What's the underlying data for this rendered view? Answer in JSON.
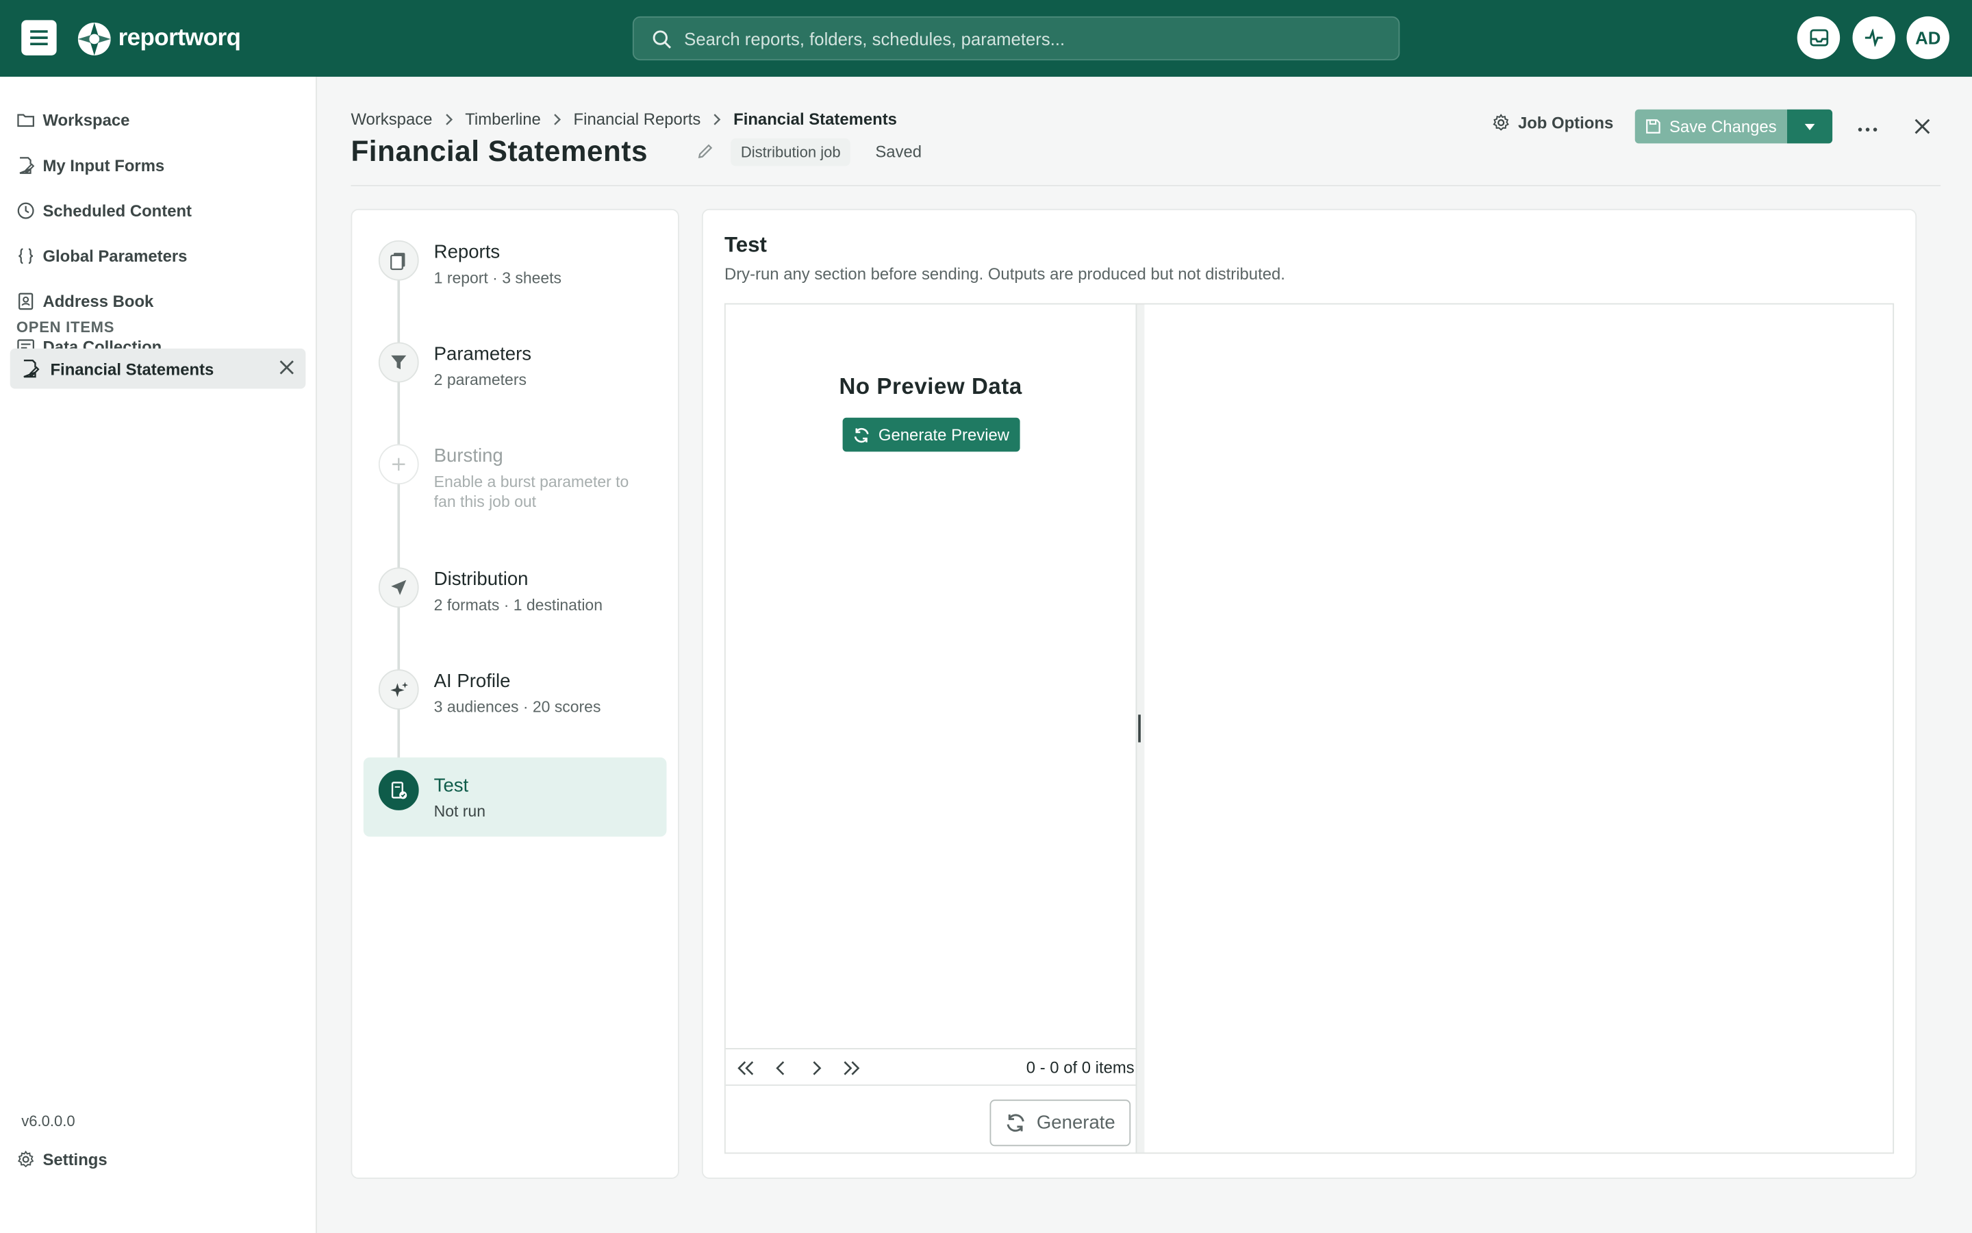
{
  "header": {
    "brand": "reportworq",
    "search_placeholder": "Search reports, folders, schedules, parameters...",
    "avatar_initials": "AD"
  },
  "sidebar": {
    "items": [
      {
        "label": "Workspace",
        "icon": "folder-icon"
      },
      {
        "label": "My Input Forms",
        "icon": "form-edit-icon"
      },
      {
        "label": "Scheduled Content",
        "icon": "clock-icon"
      },
      {
        "label": "Global Parameters",
        "icon": "braces-icon"
      },
      {
        "label": "Address Book",
        "icon": "contact-book-icon"
      },
      {
        "label": "Data Collection",
        "icon": "data-form-icon"
      }
    ],
    "open_items_label": "OPEN ITEMS",
    "open_items": [
      {
        "label": "Financial Statements"
      }
    ],
    "settings_label": "Settings",
    "version": "v6.0.0.0"
  },
  "breadcrumb": [
    "Workspace",
    "Timberline",
    "Financial Reports",
    "Financial Statements"
  ],
  "page": {
    "title": "Financial Statements",
    "badge": "Distribution job",
    "status": "Saved",
    "job_options_label": "Job Options",
    "save_label": "Save Changes"
  },
  "steps": [
    {
      "name": "Reports",
      "sub": "1 report · 3 sheets",
      "icon": "document-copy-icon",
      "state": "done"
    },
    {
      "name": "Parameters",
      "sub": "2 parameters",
      "icon": "filter-icon",
      "state": "done"
    },
    {
      "name": "Bursting",
      "sub": "Enable a burst parameter to fan this job out",
      "icon": "plus-icon",
      "state": "disabled"
    },
    {
      "name": "Distribution",
      "sub": "2 formats · 1 destination",
      "icon": "send-icon",
      "state": "done"
    },
    {
      "name": "AI Profile",
      "sub": "3 audiences · 20 scores",
      "icon": "sparkle-icon",
      "state": "done"
    },
    {
      "name": "Test",
      "sub": "Not run",
      "icon": "test-document-icon",
      "state": "active"
    }
  ],
  "test_panel": {
    "title": "Test",
    "description": "Dry-run any section before sending. Outputs are produced but not distributed.",
    "no_preview": "No Preview Data",
    "generate_preview_label": "Generate Preview",
    "pager_info": "0 - 0 of 0 items",
    "generate_label": "Generate"
  },
  "colors": {
    "brand": "#0f5c4a",
    "accent": "#1f7a62",
    "save_disabled": "#7fb5a4",
    "active_step_bg": "#e4f2ee"
  }
}
